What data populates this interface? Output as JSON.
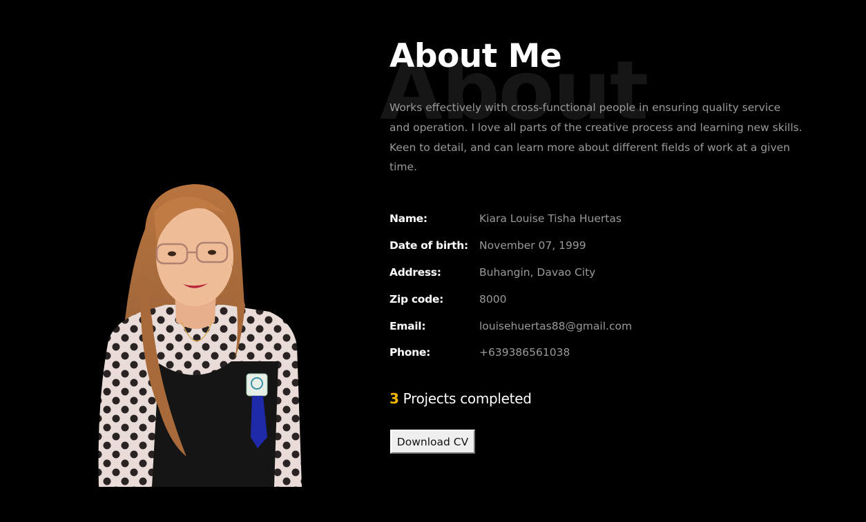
{
  "about": {
    "background_word": "About",
    "title": "About Me",
    "bio": "Works effectively with cross-functional people in ensuring quality service and operation. I love all parts of the creative process and learning new skills. Keen to detail, and can learn more about different fields of work at a given time."
  },
  "info": [
    {
      "label": "Name:",
      "value": "Kiara Louise Tisha Huertas"
    },
    {
      "label": "Date of birth:",
      "value": "November 07, 1999"
    },
    {
      "label": "Address:",
      "value": "Buhangin, Davao City"
    },
    {
      "label": "Zip code:",
      "value": "8000"
    },
    {
      "label": "Email:",
      "value": "louisehuertas88@gmail.com"
    },
    {
      "label": "Phone:",
      "value": "+639386561038"
    }
  ],
  "projects": {
    "count": "3",
    "label": " Projects completed"
  },
  "download_button": {
    "label": "Download CV"
  },
  "colors": {
    "background": "#000000",
    "heading": "#ffffff",
    "body_text": "#9a9a9a",
    "accent": "#f5b500"
  }
}
